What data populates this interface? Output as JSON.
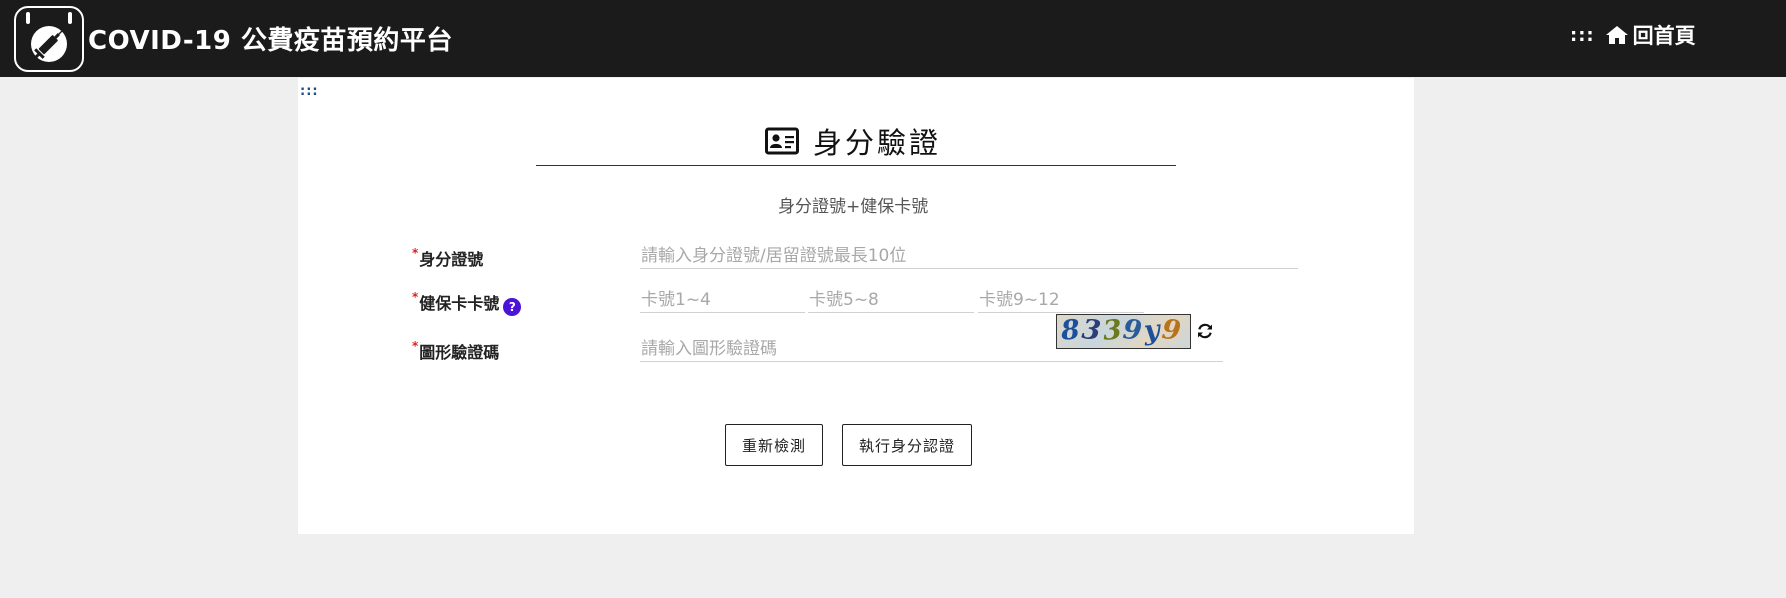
{
  "header": {
    "brand": "COVID-19 公費疫苗預約平台",
    "nav_dots": ":::",
    "home_label": "回首頁"
  },
  "skip_link": ":::",
  "page": {
    "title": "身分驗證",
    "subtitle": "身分證號+健保卡號"
  },
  "form": {
    "required_mark": "*",
    "id_label": "身分證號",
    "id_placeholder": "請輸入身分證號/居留證號最長10位",
    "nhi_label": "健保卡卡號",
    "nhi_help": "?",
    "nhi_placeholders": [
      "卡號1~4",
      "卡號5~8",
      "卡號9~12"
    ],
    "captcha_label": "圖形驗證碼",
    "captcha_placeholder": "請輸入圖形驗證碼",
    "captcha_chars": [
      {
        "ch": "8",
        "color": "#1d4f9c"
      },
      {
        "ch": "3",
        "color": "#2c3e7a"
      },
      {
        "ch": "3",
        "color": "#6b7a1a"
      },
      {
        "ch": "9",
        "color": "#2a5c9a"
      },
      {
        "ch": "y",
        "color": "#1d4f9c"
      },
      {
        "ch": "9",
        "color": "#b8731a"
      }
    ]
  },
  "buttons": {
    "reset": "重新檢測",
    "submit": "執行身分認證"
  }
}
